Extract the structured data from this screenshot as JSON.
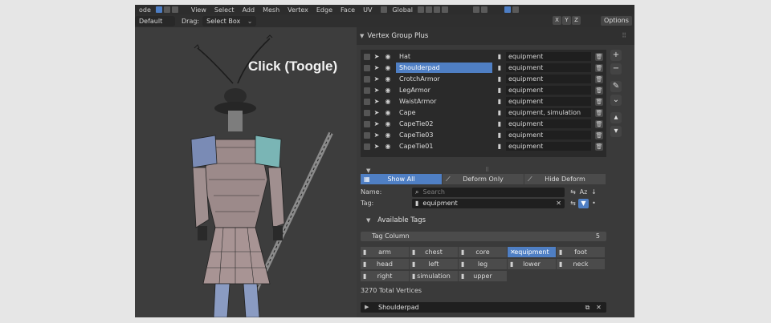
{
  "toolbar": {
    "mode_label": "ode",
    "menus": [
      "View",
      "Select",
      "Add",
      "Mesh",
      "Vertex",
      "Edge",
      "Face",
      "UV"
    ],
    "transform_label": "Global"
  },
  "subtoolbar": {
    "layout_select": "Default",
    "drag_label": "Drag:",
    "drag_select": "Select Box",
    "axes": [
      "X",
      "Y",
      "Z"
    ],
    "options_label": "Options"
  },
  "overlay": {
    "caption": "Click (Toogle)"
  },
  "panel": {
    "title": "Vertex Group Plus",
    "groups": [
      {
        "name": "Hat",
        "tag": "equipment",
        "active": false
      },
      {
        "name": "Shoulderpad",
        "tag": "equipment",
        "active": true
      },
      {
        "name": "CrotchArmor",
        "tag": "equipment",
        "active": false
      },
      {
        "name": "LegArmor",
        "tag": "equipment",
        "active": false
      },
      {
        "name": "WaistArmor",
        "tag": "equipment",
        "active": false
      },
      {
        "name": "Cape",
        "tag": "equipment, simulation",
        "active": false
      },
      {
        "name": "CapeTie02",
        "tag": "equipment",
        "active": false
      },
      {
        "name": "CapeTie03",
        "tag": "equipment",
        "active": false
      },
      {
        "name": "CapeTie01",
        "tag": "equipment",
        "active": false
      }
    ],
    "modes": [
      "Show All",
      "Deform Only",
      "Hide Deform"
    ],
    "active_mode": "Show All",
    "name_label": "Name:",
    "name_placeholder": "Search",
    "tag_label": "Tag:",
    "tag_value": "equipment",
    "available_tags_label": "Available Tags",
    "tag_column_label": "Tag Column",
    "tag_column_value": "5",
    "tags": [
      "arm",
      "chest",
      "core",
      "equipment",
      "foot",
      "head",
      "left",
      "leg",
      "lower",
      "neck",
      "right",
      "simulation",
      "upper"
    ],
    "selected_tag": "equipment",
    "total_vertices": "3270 Total Vertices",
    "active_group": "Shoulderpad"
  }
}
